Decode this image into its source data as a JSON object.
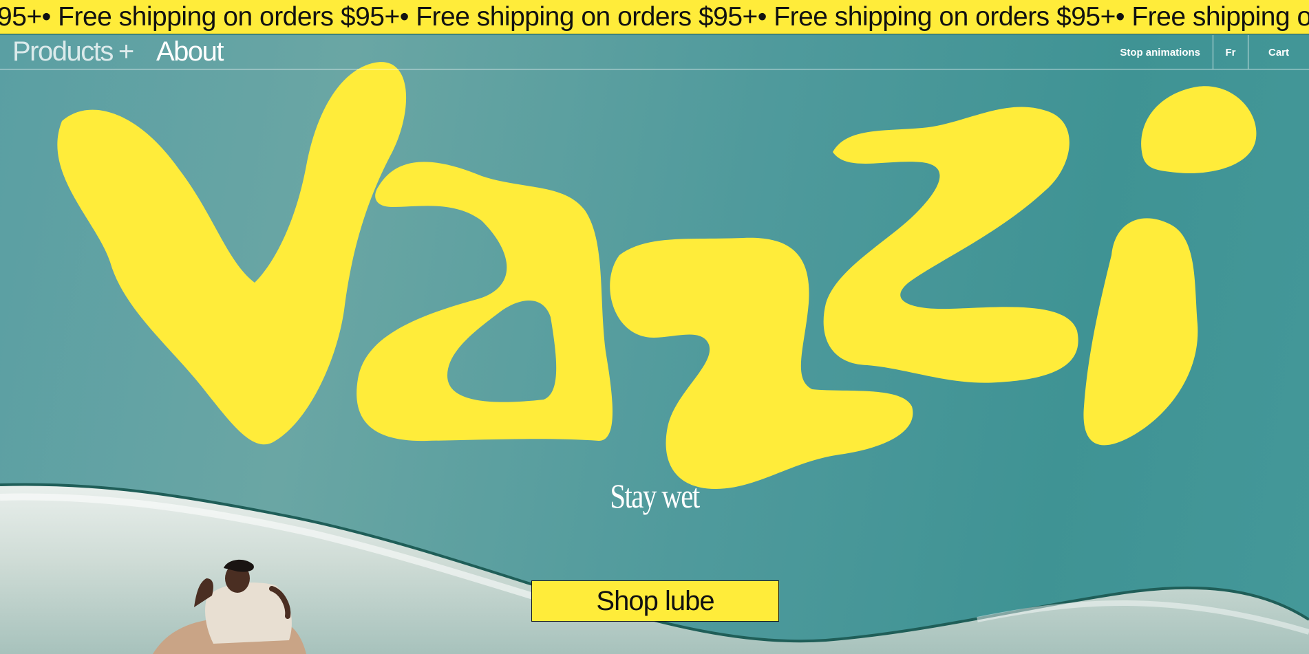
{
  "announcement": {
    "text": "95+• Free shipping on orders $95+• Free shipping on orders $95+• Free shipping on orders $95+• Free shipping on orders"
  },
  "nav": {
    "products_label": "Products",
    "about_label": "About",
    "stop_animations_label": "Stop animations",
    "language_label": "Fr",
    "cart_label": "Cart"
  },
  "hero": {
    "logo_text": "Vazzi",
    "tagline": "Stay wet",
    "cta_label": "Shop lube"
  },
  "colors": {
    "brand_yellow": "#ffec3a",
    "teal_background": "#4a9a9a",
    "nav_text": "#ffffff"
  },
  "icons": {
    "products_expand": "plus-icon"
  }
}
